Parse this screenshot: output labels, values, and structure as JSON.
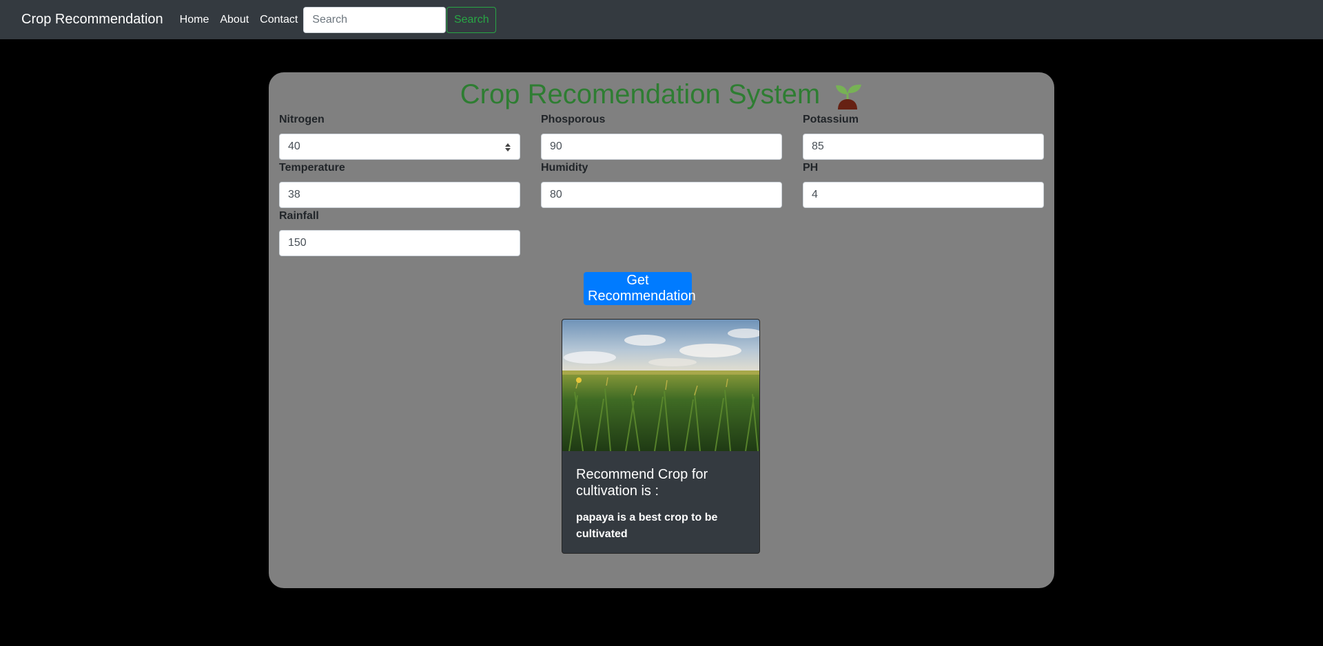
{
  "navbar": {
    "brand": "Crop Recommendation",
    "links": [
      "Home",
      "About",
      "Contact"
    ],
    "search_placeholder": "Search",
    "search_button": "Search"
  },
  "form": {
    "title": "Crop Recomendation System",
    "title_icon": "seedling-icon",
    "fields": [
      {
        "label": "Nitrogen",
        "value": "40"
      },
      {
        "label": "Phosporous",
        "value": "90"
      },
      {
        "label": "Potassium",
        "value": "85"
      },
      {
        "label": "Temperature",
        "value": "38"
      },
      {
        "label": "Humidity",
        "value": "80"
      },
      {
        "label": "PH",
        "value": "4"
      },
      {
        "label": "Rainfall",
        "value": "150"
      }
    ],
    "submit_label": "Get Recommendation"
  },
  "result_card": {
    "image": "corn-field-image",
    "title": "Recommend Crop for cultivation is :",
    "text": "papaya is a best crop to be cultivated"
  },
  "colors": {
    "navbar_bg": "#343a40",
    "page_bg": "#000000",
    "panel_bg": "#808080",
    "title_green": "#2e7d32",
    "primary": "#007bff",
    "success": "#28a745",
    "card_bg": "#343a40"
  }
}
